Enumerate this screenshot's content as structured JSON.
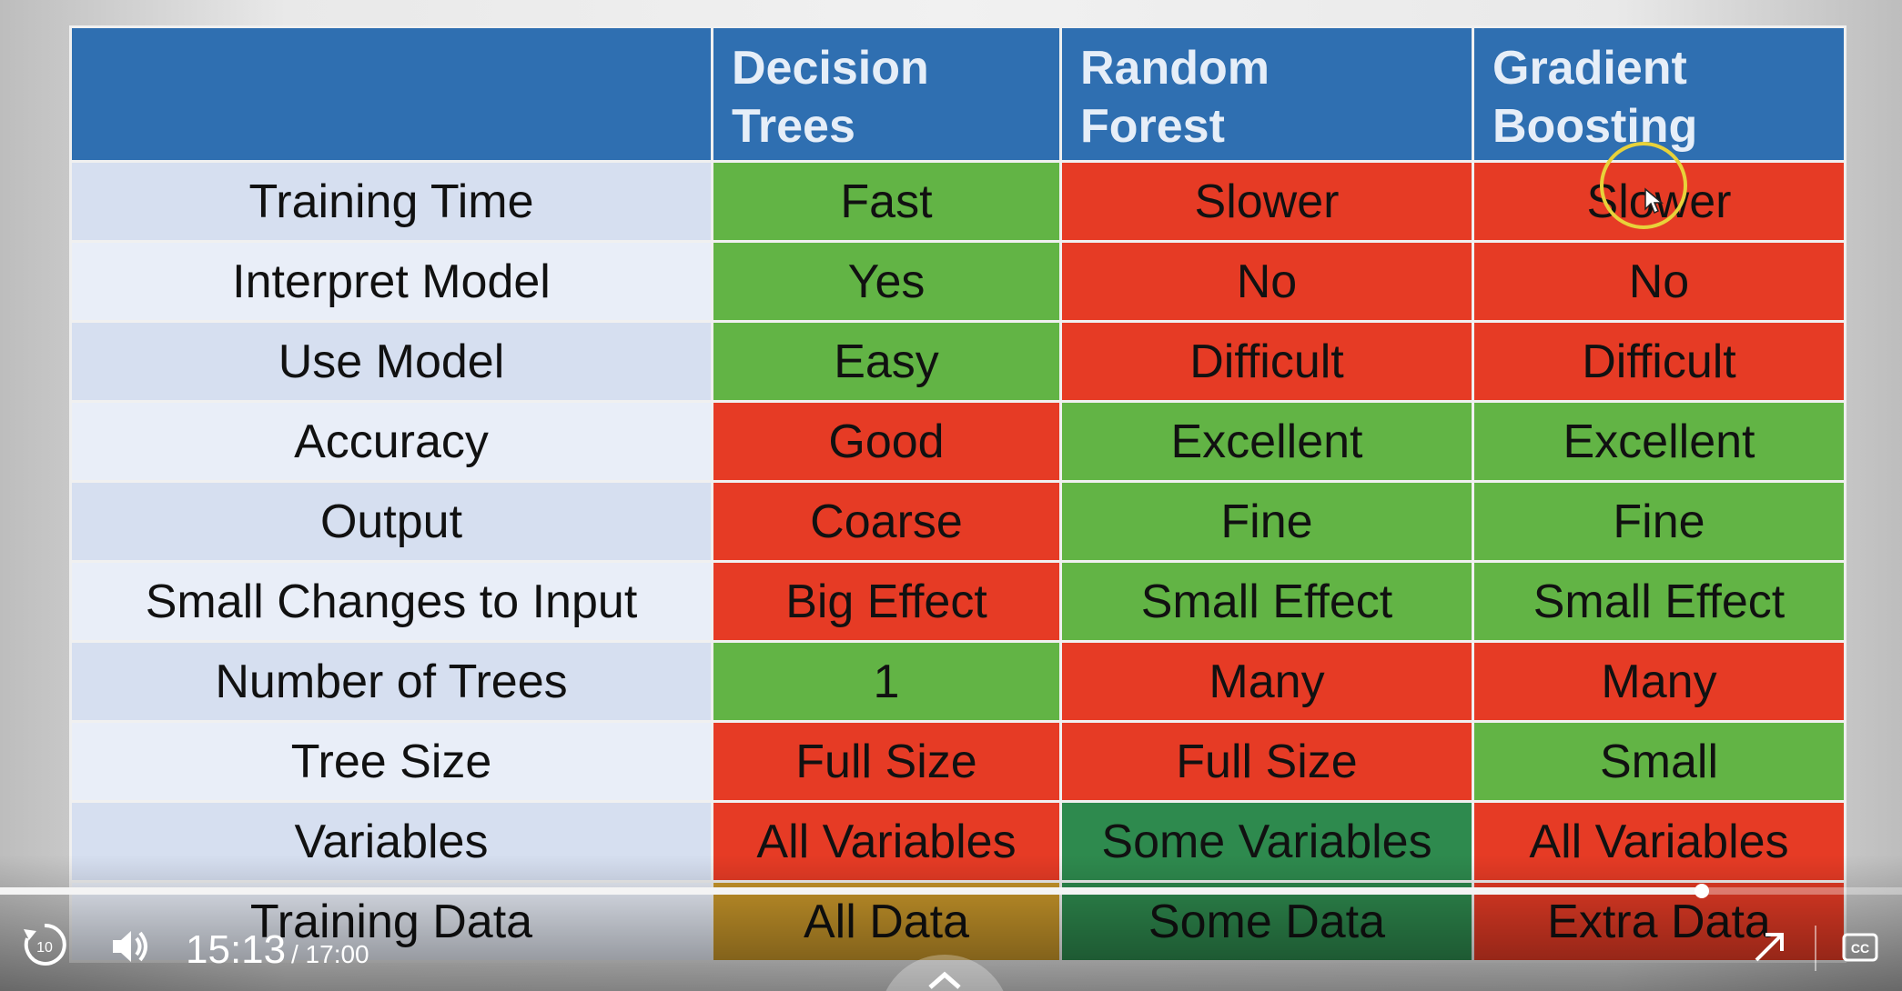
{
  "table": {
    "headers": [
      "",
      "Decision\nTrees",
      "Random\nForest",
      "Gradient\nBoosting"
    ],
    "header_lines": [
      [
        "Decision",
        "Trees"
      ],
      [
        "Random",
        "Forest"
      ],
      [
        "Gradient",
        "Boosting"
      ]
    ],
    "rows": [
      {
        "label": "Training Time",
        "cells": [
          "Fast",
          "Slower",
          "Slower"
        ],
        "colors": [
          "green",
          "red",
          "red"
        ]
      },
      {
        "label": "Interpret Model",
        "cells": [
          "Yes",
          "No",
          "No"
        ],
        "colors": [
          "green",
          "red",
          "red"
        ]
      },
      {
        "label": "Use Model",
        "cells": [
          "Easy",
          "Difficult",
          "Difficult"
        ],
        "colors": [
          "green",
          "red",
          "red"
        ]
      },
      {
        "label": "Accuracy",
        "cells": [
          "Good",
          "Excellent",
          "Excellent"
        ],
        "colors": [
          "red",
          "green",
          "green"
        ]
      },
      {
        "label": "Output",
        "cells": [
          "Coarse",
          "Fine",
          "Fine"
        ],
        "colors": [
          "red",
          "green",
          "green"
        ]
      },
      {
        "label": "Small Changes to Input",
        "cells": [
          "Big Effect",
          "Small Effect",
          "Small Effect"
        ],
        "colors": [
          "red",
          "green",
          "green"
        ]
      },
      {
        "label": "Number of Trees",
        "cells": [
          "1",
          "Many",
          "Many"
        ],
        "colors": [
          "green",
          "red",
          "red"
        ]
      },
      {
        "label": "Tree Size",
        "cells": [
          "Full Size",
          "Full Size",
          "Small"
        ],
        "colors": [
          "red",
          "red",
          "green"
        ]
      },
      {
        "label": "Variables",
        "cells": [
          "All Variables",
          "Some Variables",
          "All Variables"
        ],
        "colors": [
          "red",
          "dkgreen",
          "red"
        ]
      },
      {
        "label": "Training Data",
        "cells": [
          "All Data",
          "Some Data",
          "Extra Data"
        ],
        "colors": [
          "gold",
          "dkgreen",
          "red"
        ]
      }
    ]
  },
  "colors": {
    "header": "#2f6fb1",
    "green": "#62b445",
    "red": "#e63b25",
    "dkgreen": "#2e8a4e",
    "gold": "#c9972a"
  },
  "player": {
    "current_time": "15:13",
    "total_time": "/ 17:00",
    "progress": 0.8947,
    "rewind_label": "10",
    "icons": [
      "replay-10-icon",
      "volume-icon",
      "fullscreen-arrow-icon",
      "captions-icon",
      "chevron-up-icon"
    ]
  }
}
